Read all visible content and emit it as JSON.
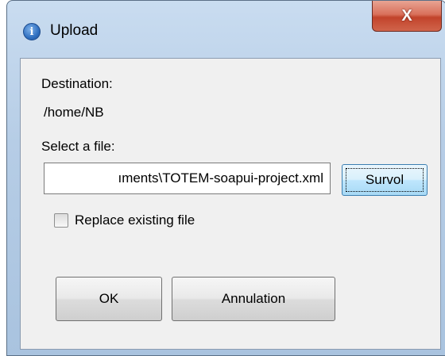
{
  "window": {
    "title": "Upload",
    "close_glyph": "X",
    "icon": "info-icon",
    "icon_glyph": "i"
  },
  "form": {
    "destination_label": "Destination:",
    "destination_value": "/home/NB",
    "file_label": "Select a file:",
    "file_value": "ıments\\TOTEM-soapui-project.xml",
    "browse_label": "Survol",
    "replace_label": "Replace existing file",
    "replace_checked": false
  },
  "actions": {
    "ok_label": "OK",
    "cancel_label": "Annulation"
  },
  "colors": {
    "title_bar": "#b6cde6",
    "close_button": "#c2432b",
    "content_bg": "#f0f0f0",
    "focused_button_border": "#3c7fb1"
  }
}
